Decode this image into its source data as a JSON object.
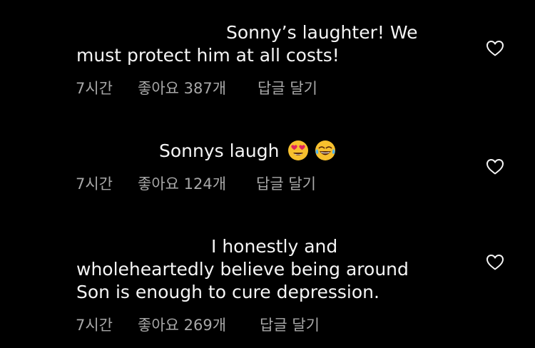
{
  "comments": [
    {
      "text_line1": "Sonny’s laughter! We",
      "text_line2": "must protect him at all costs!",
      "time": "7시간",
      "likes": "좋아요 387개",
      "reply": "답글 달기",
      "icons": [
        "heart-outline-icon"
      ]
    },
    {
      "text_line1": "Sonnys laugh",
      "time": "7시간",
      "likes": "좋아요 124개",
      "reply": "답글 달기",
      "icons": [
        "heart-eyes-emoji",
        "tears-of-joy-emoji",
        "heart-outline-icon"
      ]
    },
    {
      "text_line1": "I honestly and",
      "text_line2": "wholeheartedly believe being around",
      "text_line3": "Son is enough to cure depression.",
      "time": "7시간",
      "likes": "좋아요 269개",
      "reply": "답글 달기",
      "icons": [
        "heart-outline-icon"
      ]
    }
  ],
  "colors": {
    "background": "#000000",
    "text": "#f5f5f5",
    "meta": "#a8a8a8",
    "heart_stroke": "#f5f5f5"
  }
}
